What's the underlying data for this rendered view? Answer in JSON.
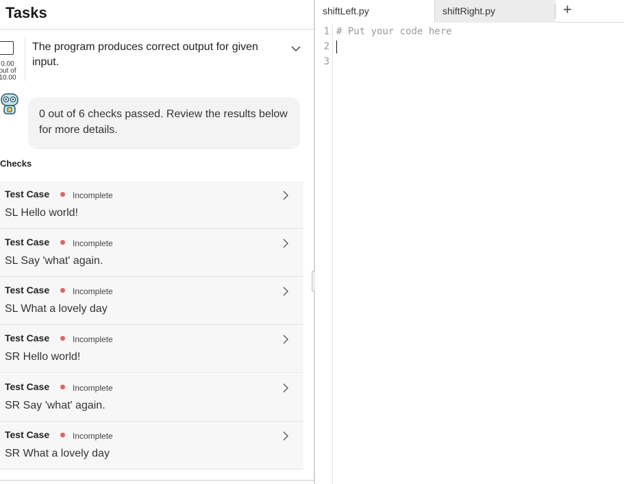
{
  "tasks": {
    "title": "Tasks",
    "task": {
      "text": "The program produces correct output for given input.",
      "points_line1": "0.00",
      "points_line2": "out of",
      "points_line3": "10.00"
    },
    "bot_message": "0 out of 6 checks passed. Review the results below for more details.",
    "checks_label": "Checks",
    "checks": [
      {
        "name": "Test Case",
        "status": "Incomplete",
        "desc": "SL Hello world!"
      },
      {
        "name": "Test Case",
        "status": "Incomplete",
        "desc": "SL Say 'what' again."
      },
      {
        "name": "Test Case",
        "status": "Incomplete",
        "desc": "SL What a lovely day"
      },
      {
        "name": "Test Case",
        "status": "Incomplete",
        "desc": "SR Hello world!"
      },
      {
        "name": "Test Case",
        "status": "Incomplete",
        "desc": "SR Say 'what' again."
      },
      {
        "name": "Test Case",
        "status": "Incomplete",
        "desc": "SR What a lovely day"
      }
    ],
    "status_color": "#e06464"
  },
  "editor": {
    "tabs": [
      {
        "label": "shiftLeft.py",
        "active": true
      },
      {
        "label": "shiftRight.py",
        "active": false
      }
    ],
    "add_tab_label": "+",
    "lines": [
      {
        "num": "1",
        "code": "# Put your code here"
      },
      {
        "num": "2",
        "code": ""
      },
      {
        "num": "3",
        "code": ""
      }
    ]
  }
}
